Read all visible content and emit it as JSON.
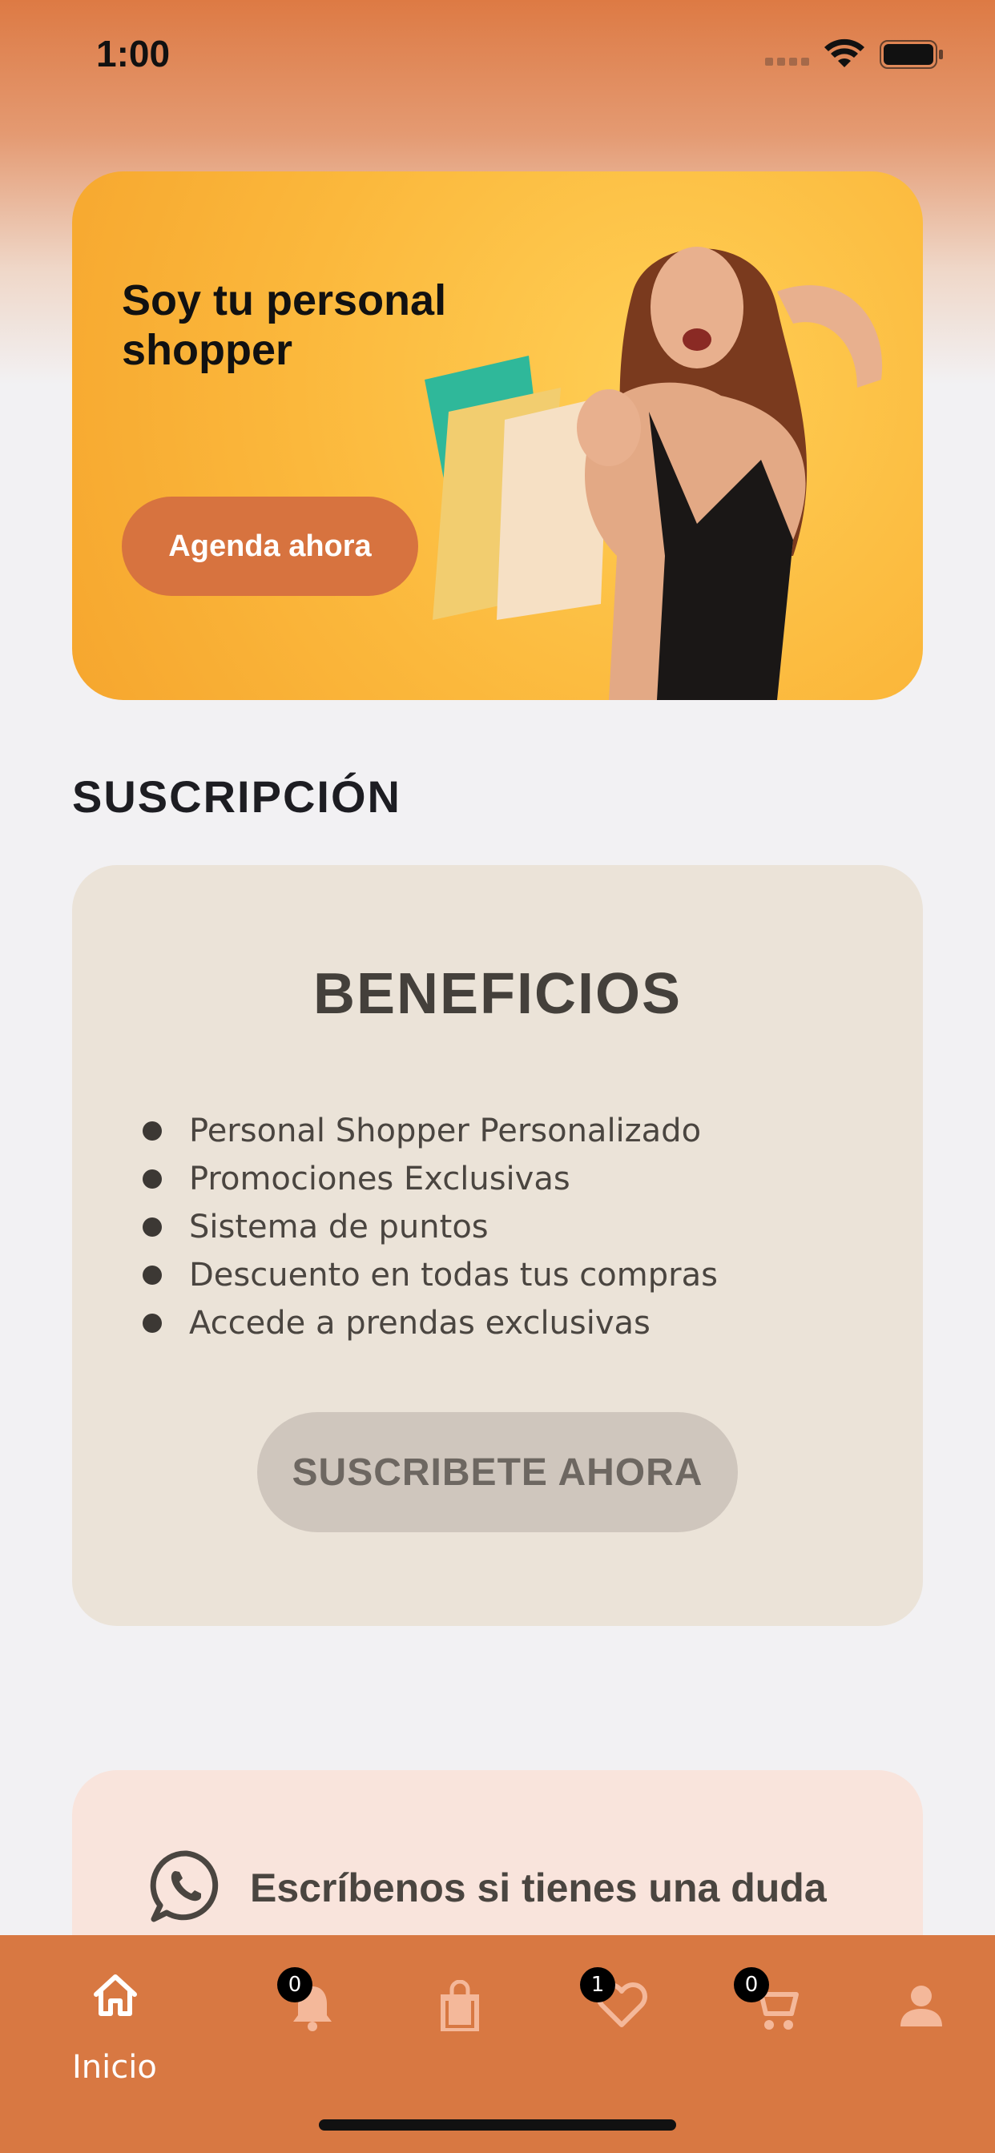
{
  "status_bar": {
    "time": "1:00"
  },
  "hero": {
    "title": "Soy tu personal shopper",
    "button_label": "Agenda ahora"
  },
  "section": {
    "title": "SUSCRIPCIÓN"
  },
  "benefits": {
    "title": "BENEFICIOS",
    "items": [
      "Personal Shopper Personalizado",
      "Promociones Exclusivas",
      "Sistema de puntos",
      "Descuento en todas tus compras",
      "Accede a prendas exclusivas"
    ],
    "button_label": "SUSCRIBETE AHORA"
  },
  "contact": {
    "text": "Escríbenos si tienes una duda"
  },
  "bottom_nav": {
    "items": [
      {
        "icon": "home-icon",
        "label": "Inicio"
      },
      {
        "icon": "bell-icon",
        "badge": "0"
      },
      {
        "icon": "shopping-bag-icon"
      },
      {
        "icon": "heart-icon",
        "badge": "1"
      },
      {
        "icon": "cart-icon",
        "badge": "0"
      },
      {
        "icon": "profile-icon"
      }
    ]
  },
  "colors": {
    "accent": "#d87842",
    "hero_background": "#fbb83c",
    "benefits_card": "#ebe3d8",
    "contact_card": "#f9e4dc"
  }
}
